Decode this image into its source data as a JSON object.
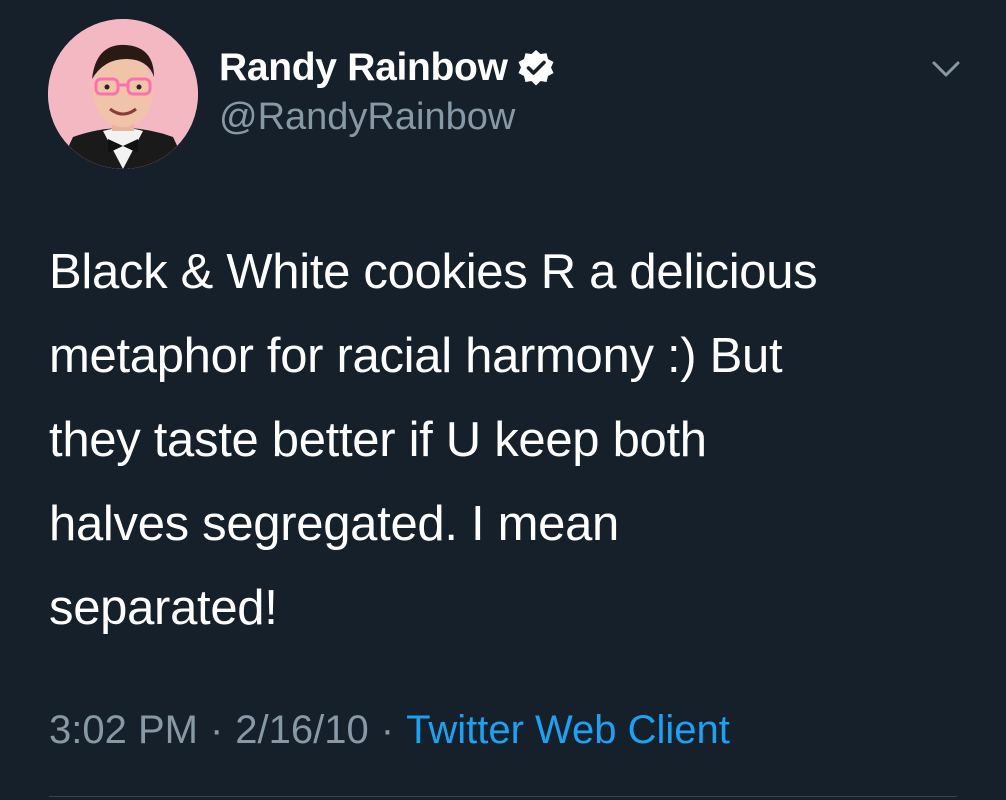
{
  "tweet": {
    "author": {
      "display_name": "Randy Rainbow",
      "handle": "@RandyRainbow",
      "verified": true,
      "avatar_icon": "profile-photo"
    },
    "text": "Black & White cookies R a delicious\nmetaphor for racial harmony :) But\nthey taste better if U keep both\nhalves segregated. I mean\nseparated!",
    "time": "3:02 PM",
    "date": "2/16/10",
    "separator": "·",
    "source": "Twitter Web Client",
    "menu_icon": "chevron-down-icon"
  },
  "colors": {
    "background": "#15202b",
    "text_primary": "#ffffff",
    "text_secondary": "#8899a6",
    "accent": "#1da1f2",
    "divider": "#38444d"
  }
}
